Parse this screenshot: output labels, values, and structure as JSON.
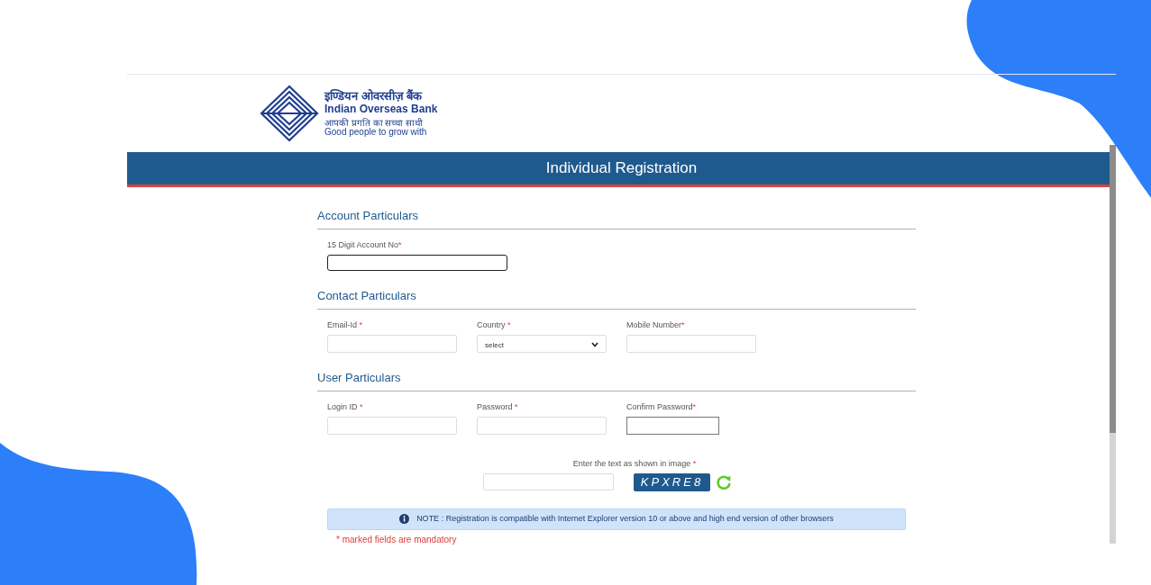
{
  "logo": {
    "hindi_name": "इण्डियन ओवरसीज़ बैंक",
    "name": "Indian Overseas Bank",
    "hindi_tagline": "आपकी प्रगति का सच्चा साथी",
    "tagline": "Good people to grow with"
  },
  "header": {
    "title": "Individual Registration"
  },
  "sections": [
    {
      "title": "Account Particulars",
      "fields": [
        {
          "label": "15 Digit Account No",
          "mark": "*",
          "kind": "input",
          "focused": true
        }
      ]
    },
    {
      "title": "Contact Particulars",
      "fields": [
        {
          "label": "Email-Id ",
          "mark": "*",
          "kind": "input",
          "focused": false
        },
        {
          "label": "Country ",
          "mark": "*",
          "kind": "select",
          "value": "select",
          "focused": false
        },
        {
          "label": "Mobile Number",
          "mark": "*",
          "kind": "input",
          "focused": false
        }
      ]
    },
    {
      "title": "User Particulars",
      "fields": [
        {
          "label": "Login ID ",
          "mark": "*",
          "kind": "input",
          "focused": false
        },
        {
          "label": "Password ",
          "mark": "*",
          "kind": "input",
          "focused": false
        },
        {
          "label": "Confirm Password",
          "mark": "*",
          "kind": "input",
          "focused": true
        }
      ]
    }
  ],
  "captcha": {
    "label": "Enter the text as shown in image ",
    "mark": "*",
    "code": "KPXRE8"
  },
  "note": "NOTE : Registration is compatible with Internet Explorer version 10 or above and high end version of other browsers",
  "mandatory_note": "* marked fields are mandatory"
}
